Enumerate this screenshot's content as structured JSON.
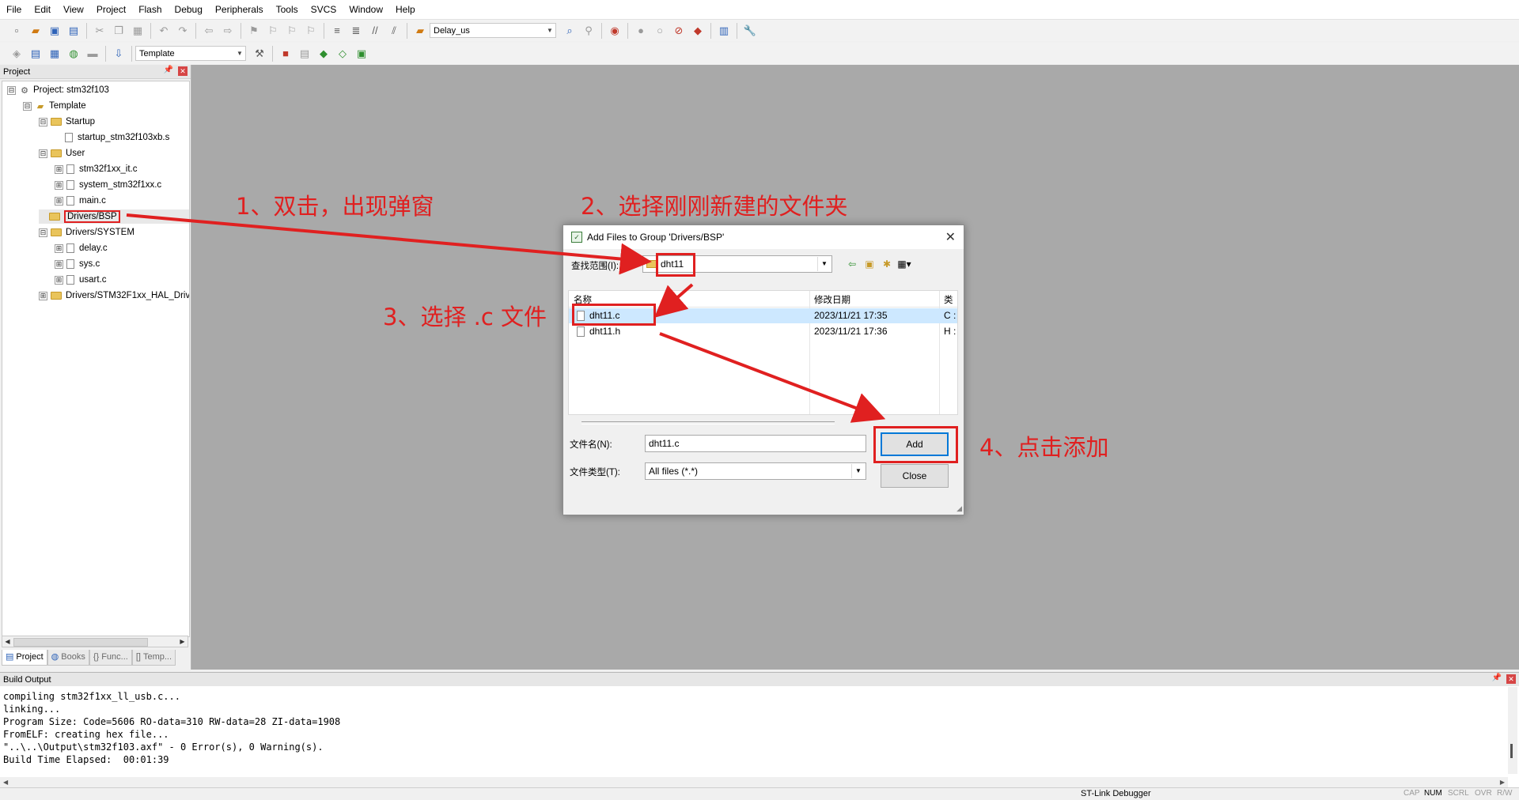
{
  "menu": [
    "File",
    "Edit",
    "View",
    "Project",
    "Flash",
    "Debug",
    "Peripherals",
    "Tools",
    "SVCS",
    "Window",
    "Help"
  ],
  "toolbar1": {
    "target_combo": "Delay_us"
  },
  "toolbar2": {
    "target_name": "Template"
  },
  "project_panel": {
    "title": "Project",
    "tree": [
      {
        "label": "Project: stm32f103",
        "indent": 0,
        "expander": "⊟",
        "icon": "project"
      },
      {
        "label": "Template",
        "indent": 1,
        "expander": "⊟",
        "icon": "target"
      },
      {
        "label": "Startup",
        "indent": 2,
        "expander": "⊟",
        "icon": "folder"
      },
      {
        "label": "startup_stm32f103xb.s",
        "indent": 3,
        "expander": "",
        "icon": "file"
      },
      {
        "label": "User",
        "indent": 2,
        "expander": "⊟",
        "icon": "folder"
      },
      {
        "label": "stm32f1xx_it.c",
        "indent": 3,
        "expander": "⊞",
        "icon": "file"
      },
      {
        "label": "system_stm32f1xx.c",
        "indent": 3,
        "expander": "⊞",
        "icon": "file"
      },
      {
        "label": "main.c",
        "indent": 3,
        "expander": "⊞",
        "icon": "file"
      },
      {
        "label": "Drivers/BSP",
        "indent": 2,
        "expander": "",
        "icon": "folder",
        "highlighted": true
      },
      {
        "label": "Drivers/SYSTEM",
        "indent": 2,
        "expander": "⊟",
        "icon": "folder"
      },
      {
        "label": "delay.c",
        "indent": 3,
        "expander": "⊞",
        "icon": "file"
      },
      {
        "label": "sys.c",
        "indent": 3,
        "expander": "⊞",
        "icon": "file"
      },
      {
        "label": "usart.c",
        "indent": 3,
        "expander": "⊞",
        "icon": "file"
      },
      {
        "label": "Drivers/STM32F1xx_HAL_Driv",
        "indent": 2,
        "expander": "⊞",
        "icon": "folder"
      }
    ],
    "tabs": [
      "Project",
      "Books",
      "Func...",
      "Temp..."
    ]
  },
  "build_output": {
    "title": "Build Output",
    "lines": [
      "compiling stm32f1xx_ll_usb.c...",
      "linking...",
      "Program Size: Code=5606 RO-data=310 RW-data=28 ZI-data=1908",
      "FromELF: creating hex file...",
      "\"..\\..\\Output\\stm32f103.axf\" - 0 Error(s), 0 Warning(s).",
      "Build Time Elapsed:  00:01:39"
    ]
  },
  "status_bar": {
    "debugger": "ST-Link Debugger",
    "indicators": [
      "CAP",
      "NUM",
      "SCRL",
      "OVR",
      "R/W"
    ],
    "active_indicator": "NUM"
  },
  "dialog": {
    "title": "Add Files to Group 'Drivers/BSP'",
    "look_in_label": "查找范围(I):",
    "look_in_value": "dht11",
    "columns": [
      "名称",
      "修改日期",
      "类"
    ],
    "files": [
      {
        "name": "dht11.c",
        "date": "2023/11/21 17:35",
        "type": "C :",
        "selected": true
      },
      {
        "name": "dht11.h",
        "date": "2023/11/21 17:36",
        "type": "H :",
        "selected": false
      }
    ],
    "filename_label": "文件名(N):",
    "filename_value": "dht11.c",
    "filetype_label": "文件类型(T):",
    "filetype_value": "All files (*.*)",
    "add_button": "Add",
    "close_button": "Close"
  },
  "annotations": {
    "step1": "1、双击，出现弹窗",
    "step2": "2、选择刚刚新建的文件夹",
    "step3": "3、选择 .c 文件",
    "step4": "4、点击添加"
  },
  "colors": {
    "annotation_red": "#e02020",
    "workspace_gray": "#a9a9a9",
    "selection_blue": "#cde8ff",
    "default_button_border": "#0078d7"
  }
}
